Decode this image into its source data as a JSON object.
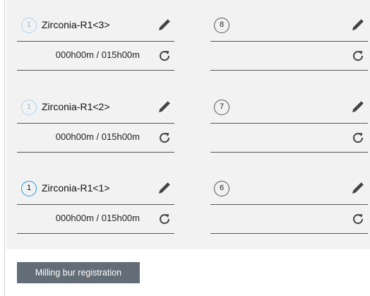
{
  "slots_left": [
    {
      "number": "1",
      "name": "Zirconia-R1<3>",
      "time": "000h00m / 015h00m",
      "state": "inactive"
    },
    {
      "number": "1",
      "name": "Zirconia-R1<2>",
      "time": "000h00m / 015h00m",
      "state": "inactive"
    },
    {
      "number": "1",
      "name": "Zirconia-R1<1>",
      "time": "000h00m / 015h00m",
      "state": "active"
    }
  ],
  "slots_right": [
    {
      "number": "8"
    },
    {
      "number": "7"
    },
    {
      "number": "6"
    }
  ],
  "register_button_label": "Milling bur registration",
  "colors": {
    "panel": "#f2f2f2",
    "accent_active": "#1d9ad6",
    "accent_inactive": "#a9d3f5",
    "button": "#636d77",
    "icon": "#444444"
  },
  "icons": {
    "edit": "pencil-icon",
    "reset": "refresh-icon"
  }
}
